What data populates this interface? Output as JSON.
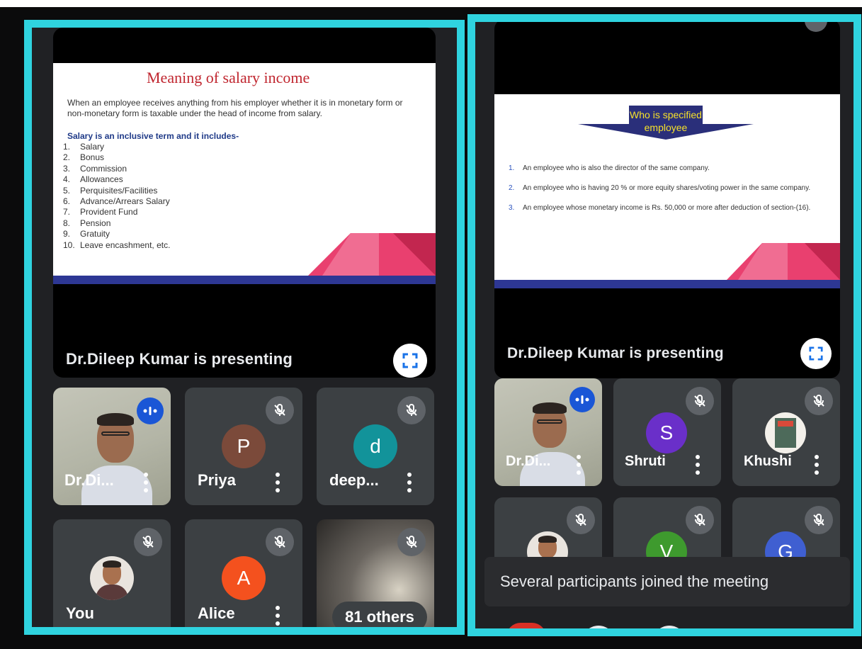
{
  "left_panel": {
    "slide": {
      "title": "Meaning of salary income",
      "intro": "When an employee receives anything from his employer whether it is in monetary form or non-monetary form is taxable under the head of income from salary.",
      "subheading": "Salary is an inclusive term and it includes-",
      "items": [
        {
          "n": "1.",
          "text": "Salary"
        },
        {
          "n": "2.",
          "text": "Bonus"
        },
        {
          "n": "3.",
          "text": "Commission"
        },
        {
          "n": "4.",
          "text": "Allowances"
        },
        {
          "n": "5.",
          "text": "Perquisites/Facilities"
        },
        {
          "n": "6.",
          "text": "Advance/Arrears Salary"
        },
        {
          "n": "7.",
          "text": "Provident Fund"
        },
        {
          "n": "8.",
          "text": "Pension"
        },
        {
          "n": "9.",
          "text": "Gratuity"
        },
        {
          "n": "10.",
          "text": "Leave encashment, etc."
        }
      ]
    },
    "presenting_label": "Dr.Dileep Kumar is presenting",
    "tiles": [
      {
        "name": "Dr.Di...",
        "kind": "video"
      },
      {
        "name": "Priya",
        "initial": "P",
        "color": "#7b4a3a"
      },
      {
        "name": "deep...",
        "initial": "d",
        "color": "#12939a"
      },
      {
        "name": "You",
        "kind": "photo"
      },
      {
        "name": "Alice",
        "initial": "A",
        "color": "#f4511e"
      },
      {
        "name": "81 others",
        "kind": "others"
      }
    ]
  },
  "right_panel": {
    "slide": {
      "heading": "Who is specified employee",
      "items": [
        {
          "n": "1.",
          "text": "An employee who is also the director of the same company."
        },
        {
          "n": "2.",
          "text": "An employee who is having 20 % or more equity shares/voting power in the same company."
        },
        {
          "n": "3.",
          "text": "An employee whose monetary income is Rs. 50,000 or more after deduction of section-(16)."
        }
      ]
    },
    "presenting_label": "Dr.Dileep Kumar is presenting",
    "tiles": [
      {
        "name": "Dr.Di...",
        "kind": "video"
      },
      {
        "name": "Shruti",
        "initial": "S",
        "color": "#6a2fc9"
      },
      {
        "name": "Khushi",
        "kind": "photo"
      },
      {
        "initial": "",
        "kind": "photo"
      },
      {
        "initial": "V",
        "color": "#3e9a2e"
      },
      {
        "initial": "G",
        "color": "#3f5fd1"
      }
    ],
    "toast": "Several participants joined the meeting"
  },
  "colors": {
    "panel_border": "#2fd3df",
    "tile_bg": "#3c4043",
    "speaking_badge": "#1a56d6"
  }
}
